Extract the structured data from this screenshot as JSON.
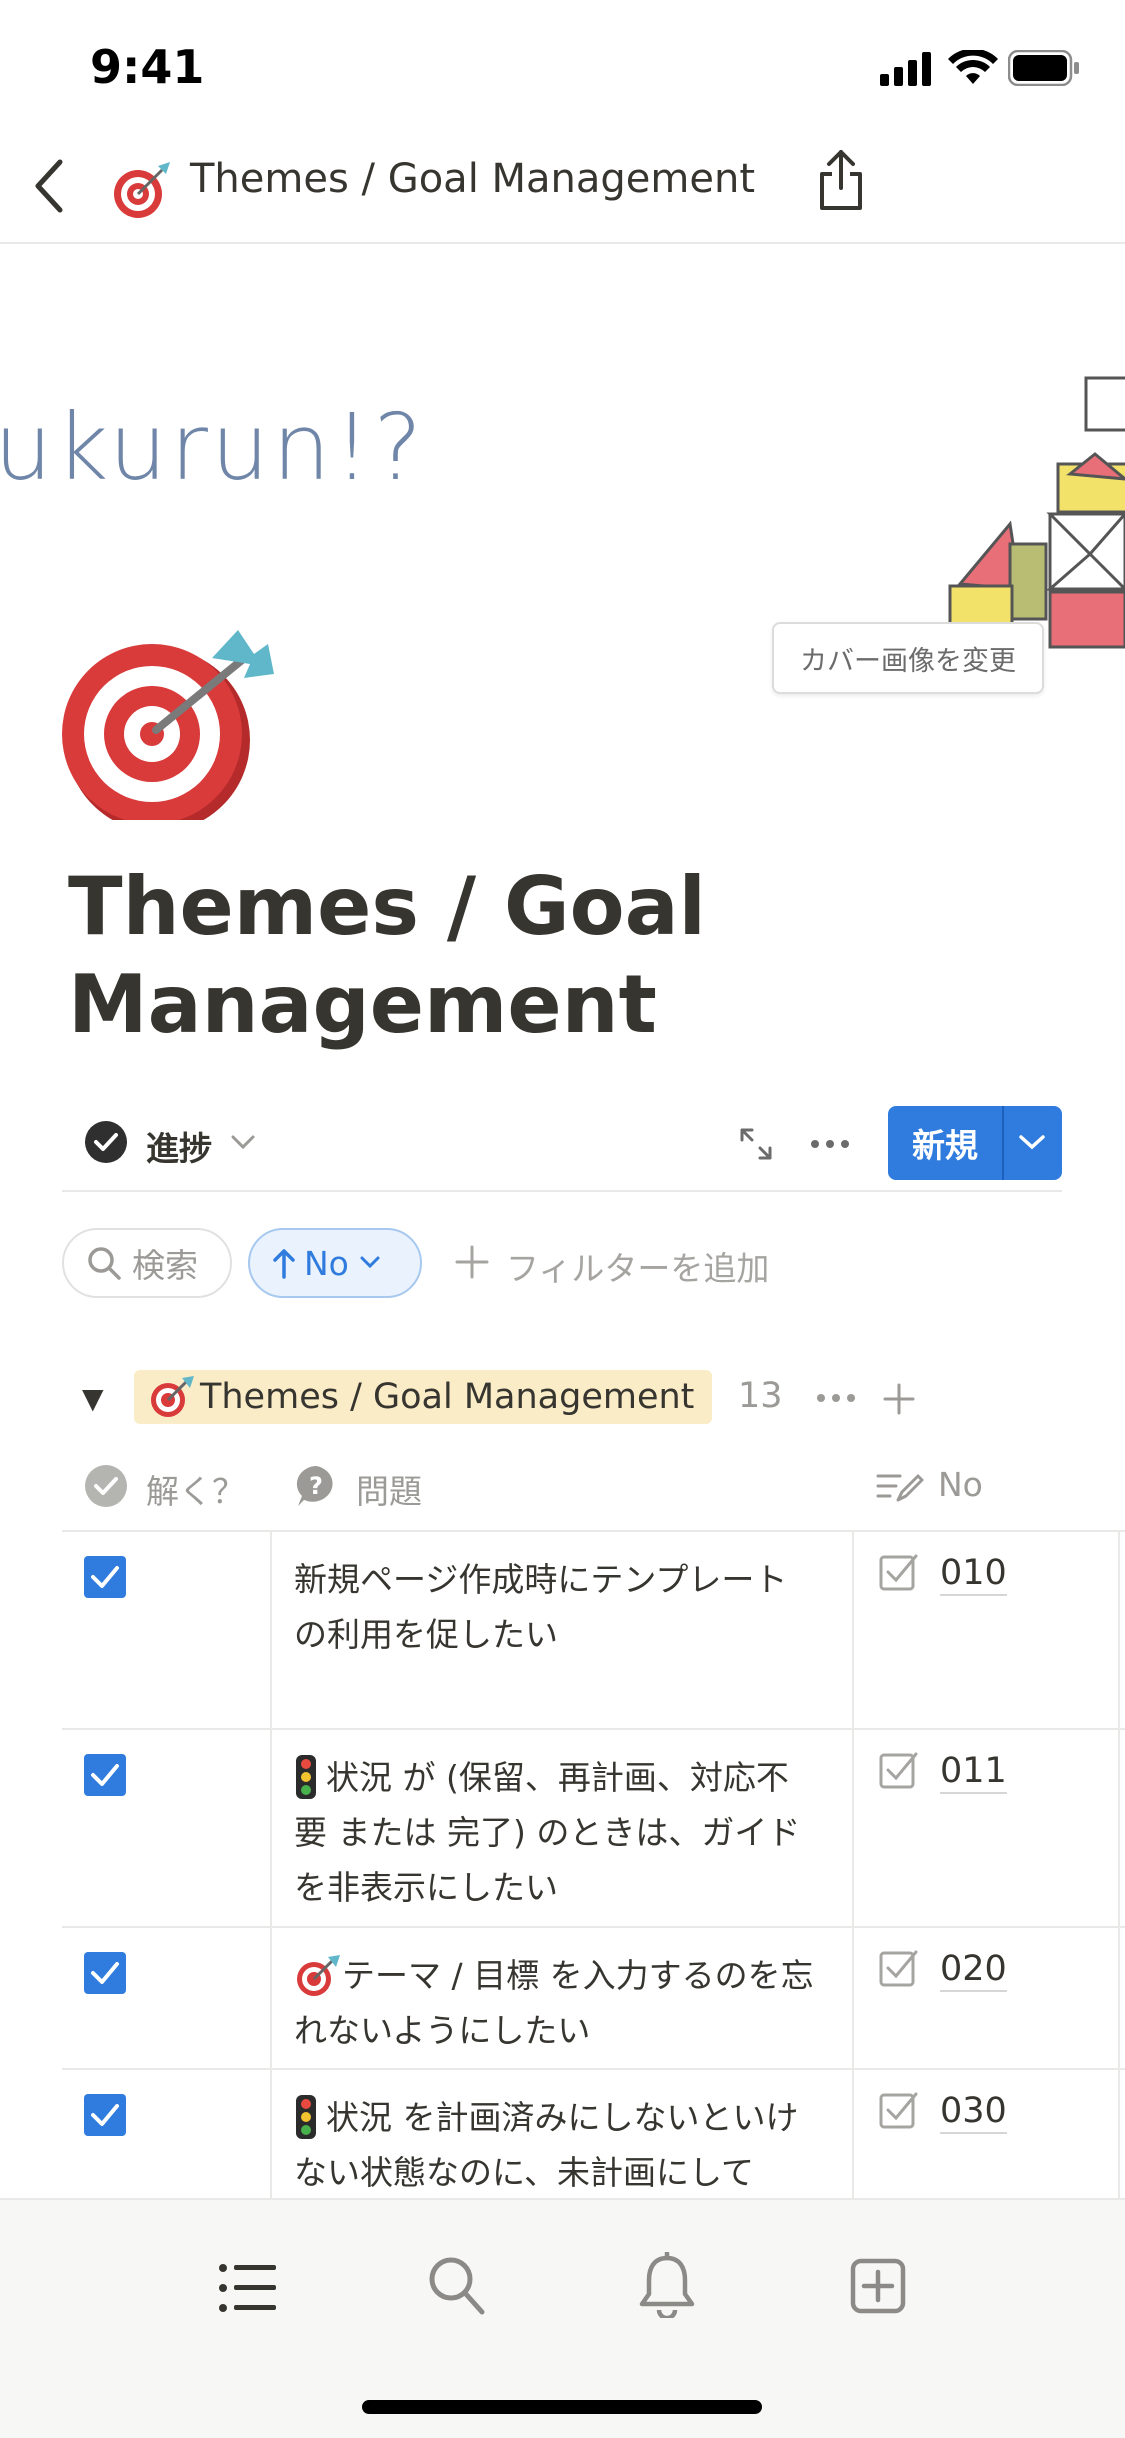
{
  "status_bar": {
    "time": "9:41"
  },
  "nav": {
    "title": "Themes / Goal Management"
  },
  "cover": {
    "text": "ukurun!?",
    "change_cover_label": "カバー画像を変更"
  },
  "page": {
    "title_line1": "Themes / Goal",
    "title_line2": "Management"
  },
  "view": {
    "name": "進捗",
    "new_label": "新規"
  },
  "filters": {
    "search_label": "検索",
    "sort_label": "No",
    "add_filter_label": "フィルターを追加"
  },
  "group": {
    "label": "Themes / Goal Management",
    "count": "13"
  },
  "columns": {
    "solve": "解く？",
    "problem": "問題",
    "no": "No"
  },
  "rows": [
    {
      "checked": true,
      "text": "新規ページ作成時にテンプレートの利用を促したい",
      "no": "010"
    },
    {
      "checked": true,
      "text": "状況 が (保留、再計画、対応不要 または 完了) のときは、ガイドを非表示にしたい",
      "no": "011"
    },
    {
      "checked": true,
      "text": "テーマ / 目標 を入力するのを忘れないようにしたい",
      "no": "020"
    },
    {
      "checked": true,
      "text": "状況 を計画済みにしないといけない状態なのに、未計画にして",
      "no": "030"
    }
  ],
  "colors": {
    "accent": "#2f7bde",
    "tag_bg": "#fbecc8",
    "text": "#37352f",
    "muted": "#9b9a97"
  },
  "icons": [
    "back-chevron-icon",
    "target-icon",
    "share-icon",
    "check-circle-icon",
    "chevron-down-icon",
    "expand-icon",
    "more-icon",
    "search-icon",
    "arrow-up-icon",
    "plus-icon",
    "question-bubble-icon",
    "text-edit-icon",
    "checkbox-icon",
    "traffic-light-icon",
    "list-icon",
    "bell-icon",
    "add-box-icon"
  ]
}
